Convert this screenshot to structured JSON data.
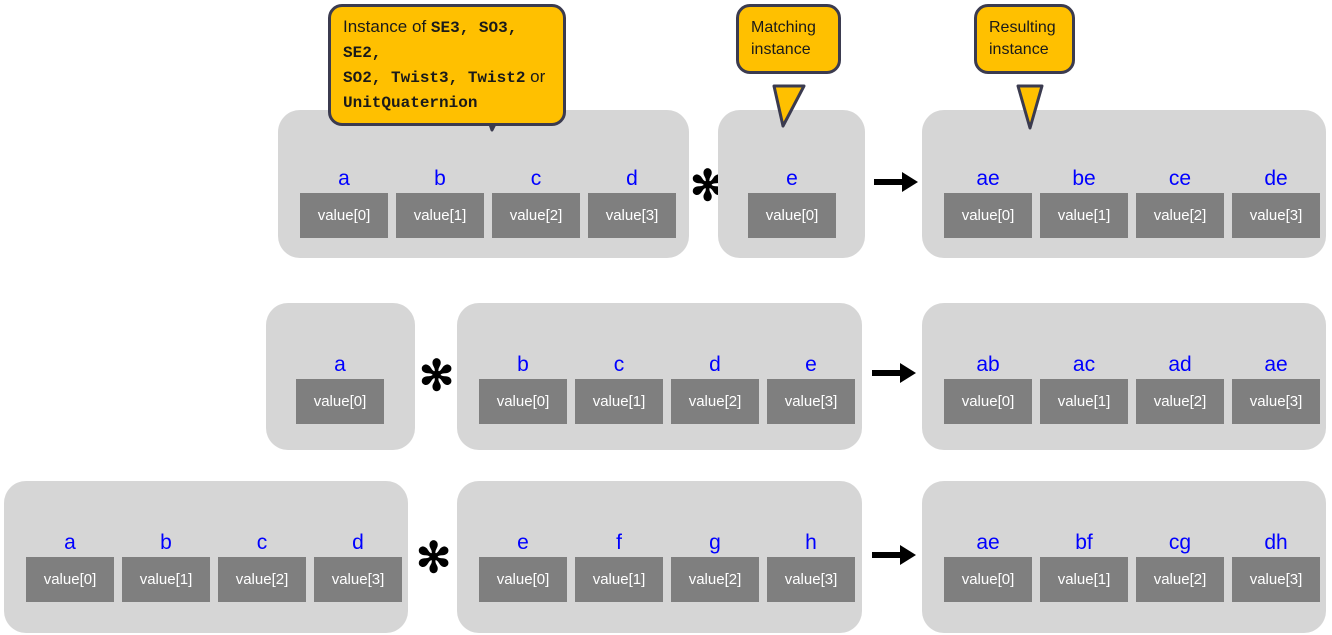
{
  "colors": {
    "panel": "#d6d6d6",
    "cell": "#7f7f7f",
    "label": "#0000ff",
    "callout_fill": "#ffc000",
    "callout_stroke": "#3b3b4f",
    "background": "#ffffff",
    "operator": "#000000"
  },
  "callouts": [
    {
      "id": "instance-of",
      "line1_prefix": "Instance of ",
      "line1_types": "SE3, SO3, SE2,",
      "line2_types": "SO2, Twist3, Twist2",
      "line2_suffix": " or",
      "line3_types": "UnitQuaternion",
      "full_text": "Instance of SE3, SO3, SE2, SO2, Twist3, Twist2 or UnitQuaternion"
    },
    {
      "id": "matching-instance",
      "line1": "Matching",
      "line2": "instance"
    },
    {
      "id": "resulting-instance",
      "line1": "Resulting",
      "line2": "instance"
    }
  ],
  "operators": {
    "multiply": "✻",
    "result": "arrow-right-icon"
  },
  "rows": [
    {
      "id": "row-1",
      "left": {
        "id": "left-operand-row-1",
        "cells": [
          {
            "label": "a",
            "value": "value[0]"
          },
          {
            "label": "b",
            "value": "value[1]"
          },
          {
            "label": "c",
            "value": "value[2]"
          },
          {
            "label": "d",
            "value": "value[3]"
          }
        ]
      },
      "right": {
        "id": "right-operand-row-1",
        "cells": [
          {
            "label": "e",
            "value": "value[0]"
          }
        ]
      },
      "result": {
        "id": "result-row-1",
        "cells": [
          {
            "label": "ae",
            "value": "value[0]"
          },
          {
            "label": "be",
            "value": "value[1]"
          },
          {
            "label": "ce",
            "value": "value[2]"
          },
          {
            "label": "de",
            "value": "value[3]"
          }
        ]
      }
    },
    {
      "id": "row-2",
      "left": {
        "id": "left-operand-row-2",
        "cells": [
          {
            "label": "a",
            "value": "value[0]"
          }
        ]
      },
      "right": {
        "id": "right-operand-row-2",
        "cells": [
          {
            "label": "b",
            "value": "value[0]"
          },
          {
            "label": "c",
            "value": "value[1]"
          },
          {
            "label": "d",
            "value": "value[2]"
          },
          {
            "label": "e",
            "value": "value[3]"
          }
        ]
      },
      "result": {
        "id": "result-row-2",
        "cells": [
          {
            "label": "ab",
            "value": "value[0]"
          },
          {
            "label": "ac",
            "value": "value[1]"
          },
          {
            "label": "ad",
            "value": "value[2]"
          },
          {
            "label": "ae",
            "value": "value[3]"
          }
        ]
      }
    },
    {
      "id": "row-3",
      "left": {
        "id": "left-operand-row-3",
        "cells": [
          {
            "label": "a",
            "value": "value[0]"
          },
          {
            "label": "b",
            "value": "value[1]"
          },
          {
            "label": "c",
            "value": "value[2]"
          },
          {
            "label": "d",
            "value": "value[3]"
          }
        ]
      },
      "right": {
        "id": "right-operand-row-3",
        "cells": [
          {
            "label": "e",
            "value": "value[0]"
          },
          {
            "label": "f",
            "value": "value[1]"
          },
          {
            "label": "g",
            "value": "value[2]"
          },
          {
            "label": "h",
            "value": "value[3]"
          }
        ]
      },
      "result": {
        "id": "result-row-3",
        "cells": [
          {
            "label": "ae",
            "value": "value[0]"
          },
          {
            "label": "bf",
            "value": "value[1]"
          },
          {
            "label": "cg",
            "value": "value[2]"
          },
          {
            "label": "dh",
            "value": "value[3]"
          }
        ]
      }
    }
  ]
}
